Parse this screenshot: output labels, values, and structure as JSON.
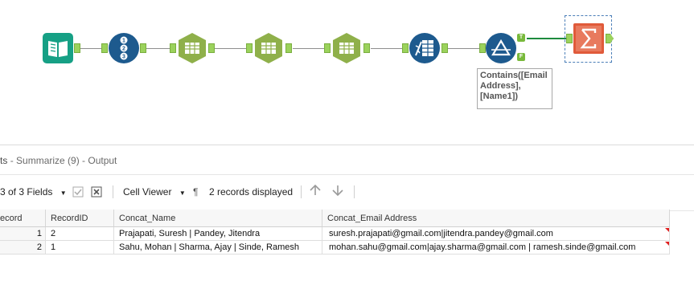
{
  "workflow": {
    "tools": [
      {
        "name": "input-data-tool",
        "color": "#16a085"
      },
      {
        "name": "record-id-tool",
        "color": "#1d5a8e"
      },
      {
        "name": "text-to-columns-tool-1",
        "color": "#8fb04a"
      },
      {
        "name": "text-to-columns-tool-2",
        "color": "#8fb04a"
      },
      {
        "name": "text-to-columns-tool-3",
        "color": "#8fb04a"
      },
      {
        "name": "append-fields-tool",
        "color": "#1d5a8e"
      },
      {
        "name": "filter-tool",
        "color": "#1d5a8e"
      },
      {
        "name": "summarize-tool",
        "color": "#e05a3a"
      }
    ],
    "filter_true_label": "T",
    "filter_false_label": "F",
    "annotation": "Contains([Email Address], [Name1])"
  },
  "results": {
    "title_prefix": "ts",
    "title_rest": "- Summarize (9) - Output",
    "toolbar": {
      "fields": "3 of 3 Fields",
      "cell_viewer": "Cell Viewer",
      "records": "2 records displayed"
    },
    "columns": [
      "ecord",
      "RecordID",
      "Concat_Name",
      "Concat_Email Address"
    ],
    "rows": [
      [
        "1",
        "2",
        "Prajapati, Suresh | Pandey, Jitendra",
        "suresh.prajapati@gmail.com|jitendra.pandey@gmail.com"
      ],
      [
        "2",
        "1",
        "Sahu, Mohan | Sharma, Ajay | Sinde, Ramesh",
        "mohan.sahu@gmail.com|ajay.sharma@gmail.com | ramesh.sinde@gmail.com"
      ]
    ]
  }
}
